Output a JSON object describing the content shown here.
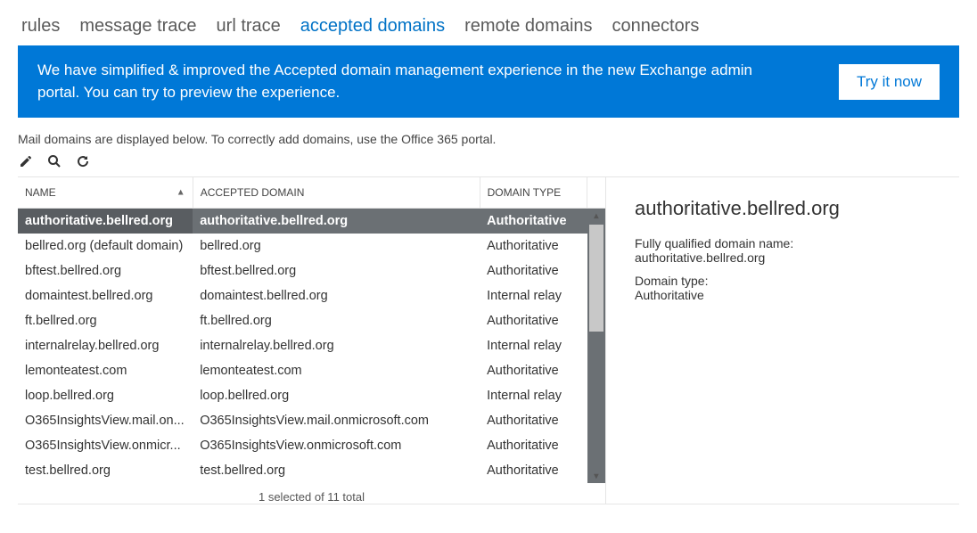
{
  "tabs": [
    "rules",
    "message trace",
    "url trace",
    "accepted domains",
    "remote domains",
    "connectors"
  ],
  "active_tab_index": 3,
  "banner": {
    "text": "We have simplified & improved the Accepted domain management experience in the new Exchange admin portal. You can try to preview the experience.",
    "cta": "Try it now"
  },
  "hint": "Mail domains are displayed below. To correctly add domains, use the Office 365 portal.",
  "columns": {
    "name": "NAME",
    "accepted": "ACCEPTED DOMAIN",
    "type": "DOMAIN TYPE"
  },
  "rows": [
    {
      "name": "authoritative.bellred.org",
      "accepted": "authoritative.bellred.org",
      "type": "Authoritative",
      "selected": true
    },
    {
      "name": "bellred.org (default domain)",
      "accepted": "bellred.org",
      "type": "Authoritative"
    },
    {
      "name": "bftest.bellred.org",
      "accepted": "bftest.bellred.org",
      "type": "Authoritative"
    },
    {
      "name": "domaintest.bellred.org",
      "accepted": "domaintest.bellred.org",
      "type": "Internal relay"
    },
    {
      "name": "ft.bellred.org",
      "accepted": "ft.bellred.org",
      "type": "Authoritative"
    },
    {
      "name": "internalrelay.bellred.org",
      "accepted": "internalrelay.bellred.org",
      "type": "Internal relay"
    },
    {
      "name": "lemonteatest.com",
      "accepted": "lemonteatest.com",
      "type": "Authoritative"
    },
    {
      "name": "loop.bellred.org",
      "accepted": "loop.bellred.org",
      "type": "Internal relay"
    },
    {
      "name": "O365InsightsView.mail.on...",
      "accepted": "O365InsightsView.mail.onmicrosoft.com",
      "type": "Authoritative"
    },
    {
      "name": "O365InsightsView.onmicr...",
      "accepted": "O365InsightsView.onmicrosoft.com",
      "type": "Authoritative"
    },
    {
      "name": "test.bellred.org",
      "accepted": "test.bellred.org",
      "type": "Authoritative"
    }
  ],
  "status": "1 selected of 11 total",
  "details": {
    "title": "authoritative.bellred.org",
    "fqdn_label": "Fully qualified domain name:",
    "fqdn_value": "authoritative.bellred.org",
    "type_label": "Domain type:",
    "type_value": "Authoritative"
  },
  "icons": {
    "edit": "edit-icon",
    "search": "search-icon",
    "refresh": "refresh-icon"
  }
}
